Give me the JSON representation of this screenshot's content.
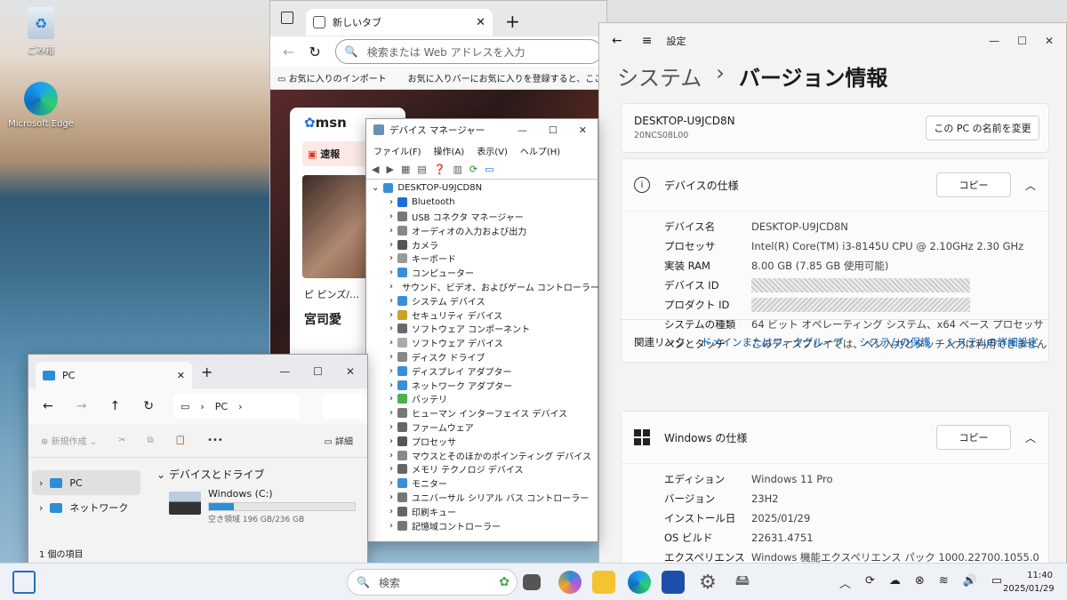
{
  "desktop": {
    "icons": [
      {
        "label": "ごみ箱",
        "icon": "recycle-bin-icon"
      },
      {
        "label": "Microsoft Edge",
        "icon": "edge-icon"
      }
    ]
  },
  "edge": {
    "tab_title": "新しいタブ",
    "address_placeholder": "検索または Web アドレスを入力",
    "fav_import": "お気に入りのインポート",
    "fav_hint": "お気に入りバーにお気に入りを登録すると、ここ",
    "msn_logo": "msn",
    "msn_tab": "速報",
    "msn_headline1": "ピ ピンズ/…",
    "msn_headline2": "宮司愛"
  },
  "settings": {
    "app_title": "設定",
    "breadcrumb_parent": "システム",
    "breadcrumb_sep": "›",
    "breadcrumb_current": "バージョン情報",
    "device_name": "DESKTOP-U9JCD8N",
    "device_model": "20NCS08L00",
    "rename_button": "この PC の名前を変更",
    "device_spec": {
      "title": "デバイスの仕様",
      "copy": "コピー",
      "rows": [
        {
          "k": "デバイス名",
          "v": "DESKTOP-U9JCD8N"
        },
        {
          "k": "プロセッサ",
          "v": "Intel(R) Core(TM) i3-8145U CPU @ 2.10GHz   2.30 GHz"
        },
        {
          "k": "実装 RAM",
          "v": "8.00 GB (7.85 GB 使用可能)"
        },
        {
          "k": "デバイス ID",
          "v": ""
        },
        {
          "k": "プロダクト ID",
          "v": ""
        },
        {
          "k": "システムの種類",
          "v": "64 ビット オペレーティング システム、x64 ベース プロセッサ"
        },
        {
          "k": "ペンとタッチ",
          "v": "このディスプレイでは、ペン入力とタッチ入力は利用できません"
        }
      ]
    },
    "related": {
      "label": "関連リンク",
      "links": [
        "ドメインまたはワークグループ",
        "システムの保護",
        "システムの詳細設定"
      ]
    },
    "win_spec": {
      "title": "Windows の仕様",
      "copy": "コピー",
      "rows": [
        {
          "k": "エディション",
          "v": "Windows 11 Pro"
        },
        {
          "k": "バージョン",
          "v": "23H2"
        },
        {
          "k": "インストール日",
          "v": "2025/01/29"
        },
        {
          "k": "OS ビルド",
          "v": "22631.4751"
        },
        {
          "k": "エクスペリエンス",
          "v": "Windows 機能エクスペリエンス パック 1000.22700.1055.0"
        }
      ]
    }
  },
  "devmgr": {
    "title": "デバイス マネージャー",
    "menu": [
      "ファイル(F)",
      "操作(A)",
      "表示(V)",
      "ヘルプ(H)"
    ],
    "root": "DESKTOP-U9JCD8N",
    "items": [
      {
        "label": "Bluetooth",
        "color": "#1e6fd9"
      },
      {
        "label": "USB コネクタ マネージャー",
        "color": "#777"
      },
      {
        "label": "オーディオの入力および出力",
        "color": "#888"
      },
      {
        "label": "カメラ",
        "color": "#555"
      },
      {
        "label": "キーボード",
        "color": "#999"
      },
      {
        "label": "コンピューター",
        "color": "#3a8fd8"
      },
      {
        "label": "サウンド、ビデオ、およびゲーム コントローラー",
        "color": "#888"
      },
      {
        "label": "システム デバイス",
        "color": "#3a8fd8"
      },
      {
        "label": "セキュリティ デバイス",
        "color": "#c9a227"
      },
      {
        "label": "ソフトウェア コンポーネント",
        "color": "#6a6a6a"
      },
      {
        "label": "ソフトウェア デバイス",
        "color": "#aaa"
      },
      {
        "label": "ディスク ドライブ",
        "color": "#888"
      },
      {
        "label": "ディスプレイ アダプター",
        "color": "#3a8fd8"
      },
      {
        "label": "ネットワーク アダプター",
        "color": "#3a8fd8"
      },
      {
        "label": "バッテリ",
        "color": "#4caf50"
      },
      {
        "label": "ヒューマン インターフェイス デバイス",
        "color": "#777"
      },
      {
        "label": "ファームウェア",
        "color": "#666"
      },
      {
        "label": "プロセッサ",
        "color": "#555"
      },
      {
        "label": "マウスとそのほかのポインティング デバイス",
        "color": "#888"
      },
      {
        "label": "メモリ テクノロジ デバイス",
        "color": "#666"
      },
      {
        "label": "モニター",
        "color": "#3a8fd8"
      },
      {
        "label": "ユニバーサル シリアル バス コントローラー",
        "color": "#777"
      },
      {
        "label": "印刷キュー",
        "color": "#666"
      },
      {
        "label": "記憶域コントローラー",
        "color": "#777"
      }
    ]
  },
  "explorer": {
    "tab_title": "PC",
    "path": "PC",
    "new_button": "新規作成",
    "details_button": "詳細",
    "nav": [
      {
        "label": "PC"
      },
      {
        "label": "ネットワーク"
      }
    ],
    "section": "デバイスとドライブ",
    "drive_name": "Windows (C:)",
    "drive_space": "空き領域 196 GB/236 GB",
    "drive_used": 0.17,
    "status": "1 個の項目"
  },
  "taskbar": {
    "search_placeholder": "検索",
    "time": "11:40",
    "date": "2025/01/29"
  }
}
